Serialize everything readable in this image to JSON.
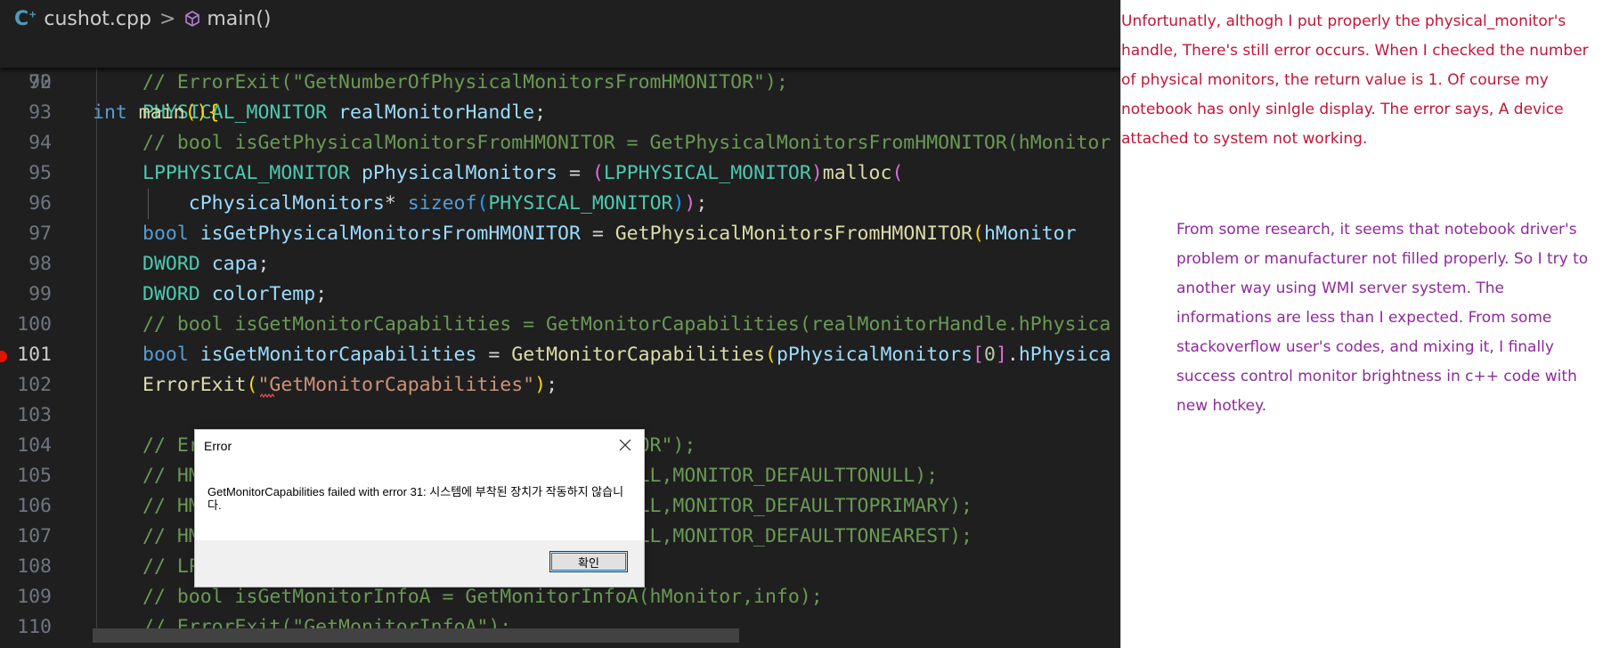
{
  "breadcrumb": {
    "file": "cushot.cpp",
    "separator": ">",
    "symbol": "main()",
    "file_icon": "cpp-file-icon",
    "symbol_icon": "cube-method-icon"
  },
  "sticky_line": {
    "number": "70",
    "code": [
      {
        "c": "k",
        "t": "int"
      },
      {
        "c": "",
        "t": " "
      },
      {
        "c": "f",
        "t": "main"
      },
      {
        "c": "b1",
        "t": "()"
      },
      {
        "c": "b1",
        "t": "{"
      }
    ]
  },
  "lines": [
    {
      "number": "92",
      "code": [
        {
          "c": "c",
          "t": "// ErrorExit(\"GetNumberOfPhysicalMonitorsFromHMONITOR\");"
        }
      ]
    },
    {
      "number": "93",
      "code": [
        {
          "c": "t",
          "t": "PHYSICAL_MONITOR"
        },
        {
          "c": "",
          "t": " "
        },
        {
          "c": "v",
          "t": "realMonitorHandle"
        },
        {
          "c": "",
          "t": ";"
        }
      ]
    },
    {
      "number": "94",
      "code": [
        {
          "c": "c",
          "t": "// bool isGetPhysicalMonitorsFromHMONITOR = GetPhysicalMonitorsFromHMONITOR(hMonitor"
        }
      ]
    },
    {
      "number": "95",
      "code": [
        {
          "c": "t",
          "t": "LPPHYSICAL_MONITOR"
        },
        {
          "c": "",
          "t": " "
        },
        {
          "c": "v",
          "t": "pPhysicalMonitors"
        },
        {
          "c": "",
          "t": " = "
        },
        {
          "c": "b2",
          "t": "("
        },
        {
          "c": "t",
          "t": "LPPHYSICAL_MONITOR"
        },
        {
          "c": "b2",
          "t": ")"
        },
        {
          "c": "f",
          "t": "malloc"
        },
        {
          "c": "b2",
          "t": "("
        }
      ]
    },
    {
      "number": "96",
      "code": [
        {
          "c": "",
          "t": "    "
        },
        {
          "c": "v",
          "t": "cPhysicalMonitors"
        },
        {
          "c": "",
          "t": "* "
        },
        {
          "c": "k",
          "t": "sizeof"
        },
        {
          "c": "b3",
          "t": "("
        },
        {
          "c": "t",
          "t": "PHYSICAL_MONITOR"
        },
        {
          "c": "b3",
          "t": ")"
        },
        {
          "c": "b2",
          "t": ")"
        },
        {
          "c": "",
          "t": ";"
        }
      ]
    },
    {
      "number": "97",
      "code": [
        {
          "c": "k",
          "t": "bool"
        },
        {
          "c": "",
          "t": " "
        },
        {
          "c": "v",
          "t": "isGetPhysicalMonitorsFromHMONITOR"
        },
        {
          "c": "",
          "t": " = "
        },
        {
          "c": "f",
          "t": "GetPhysicalMonitorsFromHMONITOR"
        },
        {
          "c": "b1",
          "t": "("
        },
        {
          "c": "v",
          "t": "hMonitor"
        }
      ]
    },
    {
      "number": "98",
      "code": [
        {
          "c": "t",
          "t": "DWORD"
        },
        {
          "c": "",
          "t": " "
        },
        {
          "c": "v",
          "t": "capa"
        },
        {
          "c": "",
          "t": ";"
        }
      ]
    },
    {
      "number": "99",
      "code": [
        {
          "c": "t",
          "t": "DWORD"
        },
        {
          "c": "",
          "t": " "
        },
        {
          "c": "v",
          "t": "colorTemp"
        },
        {
          "c": "",
          "t": ";"
        }
      ]
    },
    {
      "number": "100",
      "code": [
        {
          "c": "c",
          "t": "// bool isGetMonitorCapabilities = GetMonitorCapabilities(realMonitorHandle.hPhysica"
        }
      ]
    },
    {
      "number": "101",
      "active": true,
      "code": [
        {
          "c": "k",
          "t": "bool"
        },
        {
          "c": "",
          "t": " "
        },
        {
          "c": "v",
          "t": "isGetMonitorCapabilities"
        },
        {
          "c": "",
          "t": " = "
        },
        {
          "c": "f",
          "t": "GetMonitorCapabilities"
        },
        {
          "c": "b1",
          "t": "("
        },
        {
          "c": "v",
          "t": "pPhysicalMonitors"
        },
        {
          "c": "b2",
          "t": "["
        },
        {
          "c": "n",
          "t": "0"
        },
        {
          "c": "b2",
          "t": "]"
        },
        {
          "c": "",
          "t": "."
        },
        {
          "c": "v",
          "t": "hPhysica"
        }
      ]
    },
    {
      "number": "102",
      "code": [
        {
          "c": "f",
          "t": "ErrorExit"
        },
        {
          "c": "b1",
          "t": "("
        },
        {
          "c": "s",
          "t": "\"GetMonitorCapabilities\""
        },
        {
          "c": "b1",
          "t": ")"
        },
        {
          "c": "",
          "t": ";"
        }
      ]
    },
    {
      "number": "103",
      "code": []
    },
    {
      "number": "104",
      "code": [
        {
          "c": "c",
          "t": "// ErrorExit(\"GetPhysicalMonitorsFromHMONITOR\");"
        }
      ]
    },
    {
      "number": "105",
      "code": [
        {
          "c": "c",
          "t": "// HMONITOR hMonitor = MonitorFromWindow(NULL,MONITOR_DEFAULTTONULL);"
        }
      ]
    },
    {
      "number": "106",
      "code": [
        {
          "c": "c",
          "t": "// HMONITOR hMonitor = MonitorFromWindow(NULL,MONITOR_DEFAULTTOPRIMARY);"
        }
      ]
    },
    {
      "number": "107",
      "code": [
        {
          "c": "c",
          "t": "// HMONITOR hMonitor = MonitorFromWindow(NULL,MONITOR_DEFAULTTONEAREST);"
        }
      ]
    },
    {
      "number": "108",
      "code": [
        {
          "c": "c",
          "t": "// LPMONITORINFO info;"
        }
      ]
    },
    {
      "number": "109",
      "code": [
        {
          "c": "c",
          "t": "// bool isGetMonitorInfoA = GetMonitorInfoA(hMonitor,info);"
        }
      ]
    },
    {
      "number": "110",
      "code": [
        {
          "c": "c",
          "t": "// ErrorExit(\"GetMonitorInfoA\");"
        }
      ]
    }
  ],
  "dialog": {
    "title": "Error",
    "message": "GetMonitorCapabilities failed with error 31: 시스템에 부착된 장치가 작동하지 않습니다.",
    "ok_label": "확인",
    "close_icon": "close-icon"
  },
  "notes": {
    "paragraph1": "Unfortunatly, althogh I put properly the physical_monitor's handle, There's still error occurs. When I checked the number of physical monitors, the return value is 1. Of course my notebook has only sinlgle display. The error says, A device attached to system not working.",
    "paragraph2": "From some research, it seems that notebook driver's problem or manufacturer not filled properly. So I try to another way using WMI server system. The informations are less than I expected. From some stackoverflow user's codes, and mixing it, I finally success control monitor brightness in c++ code with new hotkey.",
    "color1": "#c0163a",
    "color2": "#8e2a9a"
  }
}
